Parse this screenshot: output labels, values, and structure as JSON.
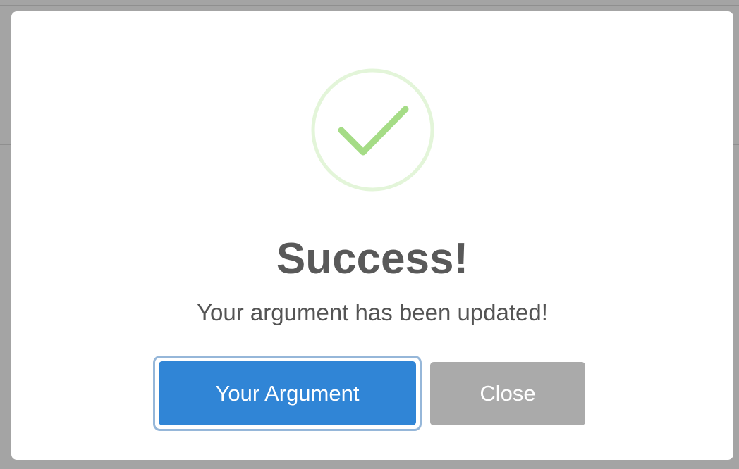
{
  "modal": {
    "title": "Success!",
    "message": "Your argument has been updated!",
    "icon": "success-check-icon",
    "colors": {
      "check": "#a5dc86",
      "ring": "#e3f5d9",
      "title": "#595959",
      "text": "#545454",
      "confirm_bg": "#3085d6",
      "cancel_bg": "#aaaaaa"
    }
  },
  "buttons": {
    "confirm_label": "Your Argument",
    "cancel_label": "Close"
  }
}
